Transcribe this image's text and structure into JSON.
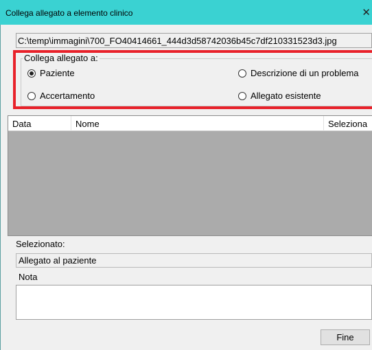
{
  "window": {
    "title": "Collega allegato a elemento clinico",
    "close_glyph": "✕"
  },
  "file_path": "C:\\temp\\immagini\\700_FO40414661_444d3d58742036b45c7df210331523d3.jpg",
  "link_group": {
    "label": "Collega allegato a:",
    "options": [
      {
        "label": "Paziente",
        "checked": true
      },
      {
        "label": "Descrizione di un problema",
        "checked": false
      },
      {
        "label": "Accertamento",
        "checked": false
      },
      {
        "label": "Allegato esistente",
        "checked": false
      }
    ]
  },
  "table": {
    "columns": [
      "Data",
      "Nome",
      "Seleziona"
    ],
    "rows": []
  },
  "selected": {
    "label": "Selezionato:",
    "value": "Allegato al paziente"
  },
  "note": {
    "label": "Nota",
    "value": ""
  },
  "buttons": {
    "finish_label": "Fine"
  },
  "colors": {
    "titlebar": "#3ad2d2",
    "highlight": "#e8212a",
    "grid_background": "#ababab"
  }
}
